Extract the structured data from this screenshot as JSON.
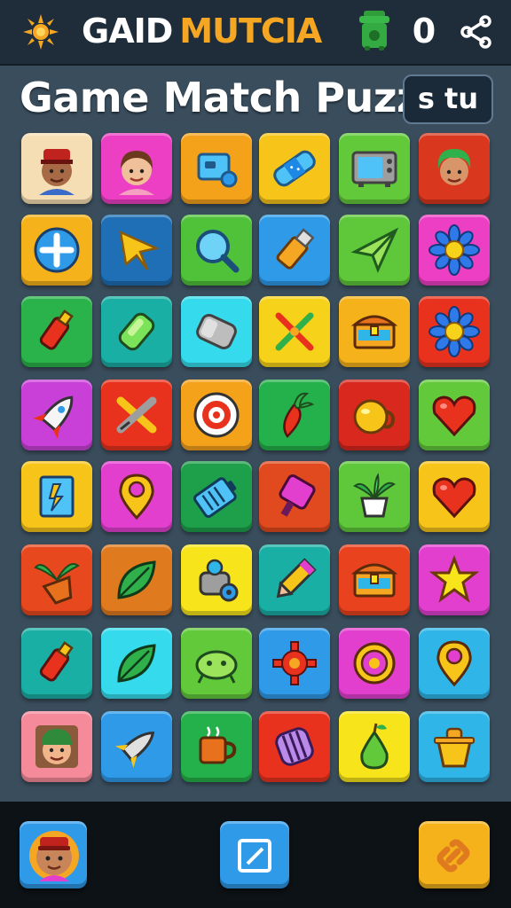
{
  "header": {
    "title_part1": "GAID",
    "title_part2": "MUTCIA",
    "score": "0",
    "icons": [
      "sun-icon",
      "trash-bin-icon",
      "share-icon"
    ],
    "accent_color": "#f5a623"
  },
  "subtitle": "Game Match Puzz",
  "mini_badge": "s tu",
  "grid": {
    "rows": 8,
    "cols": 6,
    "tiles": [
      [
        {
          "icon": "person-red-hat",
          "color": "#f5deb3"
        },
        {
          "icon": "person-brown-hair",
          "color": "#ec3fc3"
        },
        {
          "icon": "device",
          "color": "#f5a21b"
        },
        {
          "icon": "bandage",
          "color": "#f7c51a"
        },
        {
          "icon": "microwave",
          "color": "#62c93b"
        },
        {
          "icon": "person-green-hair",
          "color": "#d9381e"
        }
      ],
      [
        {
          "icon": "plus-circle",
          "color": "#f5b21b"
        },
        {
          "icon": "star-arrow",
          "color": "#1e6fb5"
        },
        {
          "icon": "magnifier",
          "color": "#4fc23a"
        },
        {
          "icon": "usb-stick",
          "color": "#2f9ae8"
        },
        {
          "icon": "paper-plane",
          "color": "#5fc73a"
        },
        {
          "icon": "blue-flower",
          "color": "#ec3fc3"
        }
      ],
      [
        {
          "icon": "paint-tube",
          "color": "#29b34a"
        },
        {
          "icon": "green-tube",
          "color": "#1aafa4"
        },
        {
          "icon": "eraser",
          "color": "#35dbec"
        },
        {
          "icon": "crossed-tools",
          "color": "#f7d21a"
        },
        {
          "icon": "treasure-box",
          "color": "#f5b21b"
        },
        {
          "icon": "blue-flower",
          "color": "#e8321e"
        }
      ],
      [
        {
          "icon": "rocket",
          "color": "#c940d9"
        },
        {
          "icon": "crossed-pencils",
          "color": "#e8321e"
        },
        {
          "icon": "target",
          "color": "#f5a21b"
        },
        {
          "icon": "carrot",
          "color": "#24b04a"
        },
        {
          "icon": "yellow-pot",
          "color": "#d9281e"
        },
        {
          "icon": "heart",
          "color": "#62c93b"
        }
      ],
      [
        {
          "icon": "card",
          "color": "#f7c51a"
        },
        {
          "icon": "location-pin",
          "color": "#e23fcf"
        },
        {
          "icon": "battery",
          "color": "#1e9f4a"
        },
        {
          "icon": "pink-gem",
          "color": "#e04a1e"
        },
        {
          "icon": "potted-plant",
          "color": "#5fc73a"
        },
        {
          "icon": "heart",
          "color": "#f7c51a"
        }
      ],
      [
        {
          "icon": "plant-pot",
          "color": "#e8481e"
        },
        {
          "icon": "green-leaf",
          "color": "#e07a1e"
        },
        {
          "icon": "robot-wheel",
          "color": "#f7e41a"
        },
        {
          "icon": "pencil",
          "color": "#1aafa4"
        },
        {
          "icon": "treasure-box",
          "color": "#e8421e"
        },
        {
          "icon": "yellow-star",
          "color": "#e23fcf"
        }
      ],
      [
        {
          "icon": "paint-tube",
          "color": "#1aafa4"
        },
        {
          "icon": "green-leaf",
          "color": "#35dbec"
        },
        {
          "icon": "green-bug",
          "color": "#62c93b"
        },
        {
          "icon": "red-gear",
          "color": "#2f9ae8"
        },
        {
          "icon": "ring-target",
          "color": "#e23fcf"
        },
        {
          "icon": "location-pin",
          "color": "#2fb5e8"
        }
      ],
      [
        {
          "icon": "person-green-cap",
          "color": "#f58a9a"
        },
        {
          "icon": "rocket-small",
          "color": "#2f9ae8"
        },
        {
          "icon": "coffee-mug",
          "color": "#24b04a"
        },
        {
          "icon": "purple-barrel",
          "color": "#e8321e"
        },
        {
          "icon": "green-pear",
          "color": "#f7e41a"
        },
        {
          "icon": "yellow-bucket",
          "color": "#2fb5e8"
        }
      ]
    ]
  },
  "bottom": {
    "avatar_icon": "avatar-icon",
    "edit_icon": "edit-icon",
    "link_icon": "link-icon"
  }
}
